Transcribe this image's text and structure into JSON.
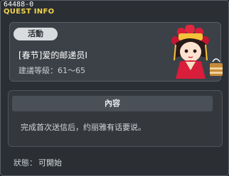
{
  "window": {
    "quest_id": "64488-0",
    "title": "QUEST INFO"
  },
  "quest": {
    "category_badge": "活動",
    "name": "[春节]爱的邮递员Ⅰ",
    "level": "建議等級：61～65"
  },
  "content": {
    "header": "內容",
    "description": "完成首次送信后，约丽雅有话要说。"
  },
  "status": {
    "label": "狀態：",
    "value": "可開始"
  },
  "colors": {
    "title": "#f2d44a",
    "background": "#2b2f34",
    "panel": "#3c4147"
  },
  "icons": {
    "npc": "npc-portrait-lunar-new-year",
    "gift": "gift-box-icon"
  }
}
